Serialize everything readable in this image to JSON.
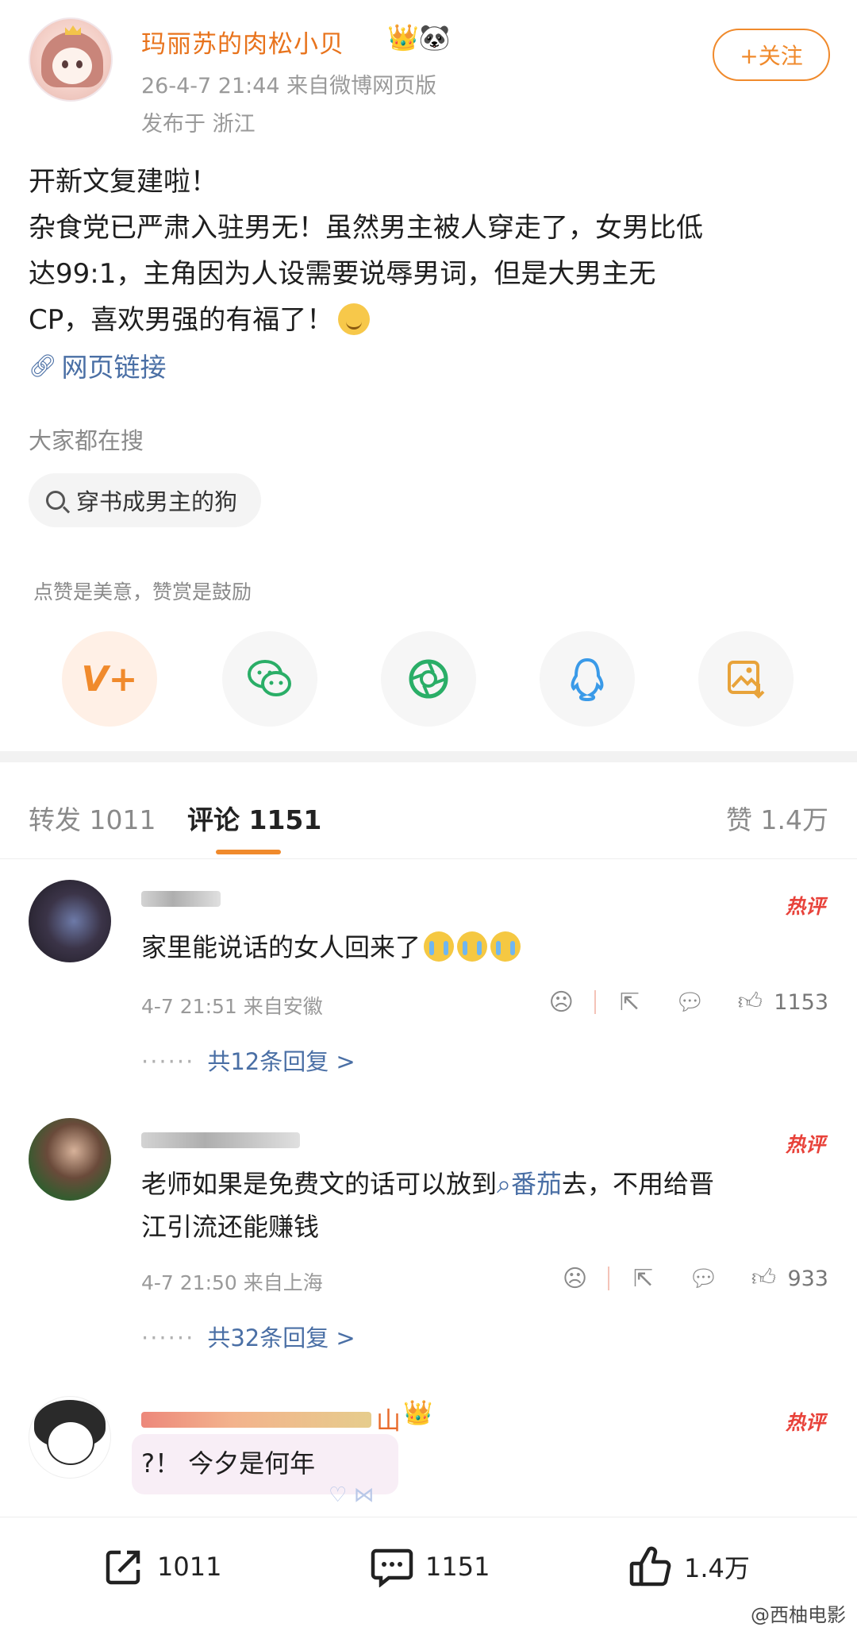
{
  "post": {
    "author": "玛丽苏的肉松小贝",
    "author_badges": "👑🐼",
    "meta": "26-4-7 21:44  来自微博网页版",
    "location": "发布于 浙江",
    "follow_label": "+关注",
    "text_lines": [
      "开新文复建啦！",
      "杂食党已严肃入驻男无！虽然男主被人穿走了，女男比低",
      "达99:1，主角因为人设需要说辱男词，但是大男主无",
      "CP，喜欢男强的有福了！"
    ],
    "link_label": "网页链接",
    "hot_search_title": "大家都在搜",
    "hot_search_query": "穿书成男主的狗",
    "reward_hint": "点赞是美意，赞赏是鼓励"
  },
  "share_buttons": [
    {
      "icon": "V+",
      "color": "#f08a2c"
    },
    {
      "icon": "wechat-icon",
      "color": "#2aae67"
    },
    {
      "icon": "moments-icon",
      "color": "#2aae67"
    },
    {
      "icon": "qq-icon",
      "color": "#3a9ae8"
    },
    {
      "icon": "save-image-icon",
      "color": "#e8a33a"
    }
  ],
  "tabs": {
    "repost": "转发 1011",
    "comments": "评论 1151",
    "likes": "赞 1.4万"
  },
  "comments": [
    {
      "text": "家里能说话的女人回来了",
      "meta": "4-7 21:51 来自安徽",
      "likes": "1153",
      "replies": "共12条回复 >",
      "hot_label": "热评"
    },
    {
      "text_before": "老师如果是免费文的话可以放到",
      "topic": "番茄",
      "text_after": "去，不用给晋",
      "text_line2": "江引流还能赚钱",
      "meta": "4-7 21:50 来自上海",
      "likes": "933",
      "replies": "共32条回复 >",
      "hot_label": "热评"
    },
    {
      "name_suffix": "山",
      "text": "?！ 今夕是何年",
      "hot_label": "热评"
    }
  ],
  "bottom_bar": {
    "reposts": "1011",
    "comments": "1151",
    "likes": "1.4万"
  },
  "watermark": "@西柚电影",
  "colors": {
    "accent": "#f08a2c",
    "link": "#4a6fa5",
    "hot": "#e8423a"
  }
}
